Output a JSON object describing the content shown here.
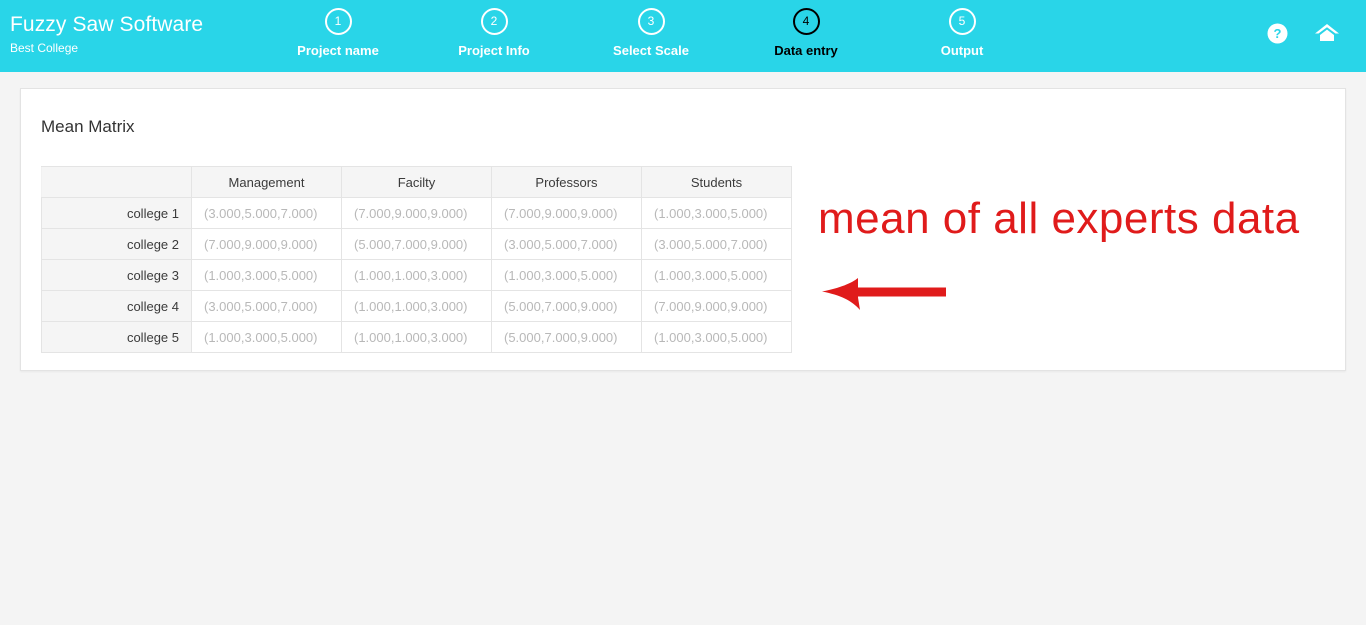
{
  "colors": {
    "header_bg": "#29d5e8",
    "page_bg": "#f4f4f4",
    "card_bg": "#ffffff",
    "annotation_red": "#e01b1b",
    "active_step": "#000000",
    "inactive_step": "#ffffff"
  },
  "header": {
    "brand_title": "Fuzzy Saw Software",
    "brand_subtitle": "Best College",
    "steps": [
      {
        "number": "1",
        "label": "Project name",
        "active": false
      },
      {
        "number": "2",
        "label": "Project Info",
        "active": false
      },
      {
        "number": "3",
        "label": "Select Scale",
        "active": false
      },
      {
        "number": "4",
        "label": "Data entry",
        "active": true
      },
      {
        "number": "5",
        "label": "Output",
        "active": false
      }
    ],
    "actions": [
      {
        "icon": "help-icon",
        "title": "Help"
      },
      {
        "icon": "home-icon",
        "title": "Home"
      }
    ]
  },
  "card": {
    "title": "Mean Matrix"
  },
  "table": {
    "corner_label": "",
    "columns": [
      "Management",
      "Facilty",
      "Professors",
      "Students"
    ],
    "rows": [
      {
        "label": "college 1",
        "values": [
          "(3.000,5.000,7.000)",
          "(7.000,9.000,9.000)",
          "(7.000,9.000,9.000)",
          "(1.000,3.000,5.000)"
        ]
      },
      {
        "label": "college 2",
        "values": [
          "(7.000,9.000,9.000)",
          "(5.000,7.000,9.000)",
          "(3.000,5.000,7.000)",
          "(3.000,5.000,7.000)"
        ]
      },
      {
        "label": "college 3",
        "values": [
          "(1.000,3.000,5.000)",
          "(1.000,1.000,3.000)",
          "(1.000,3.000,5.000)",
          "(1.000,3.000,5.000)"
        ]
      },
      {
        "label": "college 4",
        "values": [
          "(3.000,5.000,7.000)",
          "(1.000,1.000,3.000)",
          "(5.000,7.000,9.000)",
          "(7.000,9.000,9.000)"
        ]
      },
      {
        "label": "college 5",
        "values": [
          "(1.000,3.000,5.000)",
          "(1.000,1.000,3.000)",
          "(5.000,7.000,9.000)",
          "(1.000,3.000,5.000)"
        ]
      }
    ]
  },
  "annotation": {
    "text": "mean of all experts data",
    "arrow_direction": "left"
  }
}
